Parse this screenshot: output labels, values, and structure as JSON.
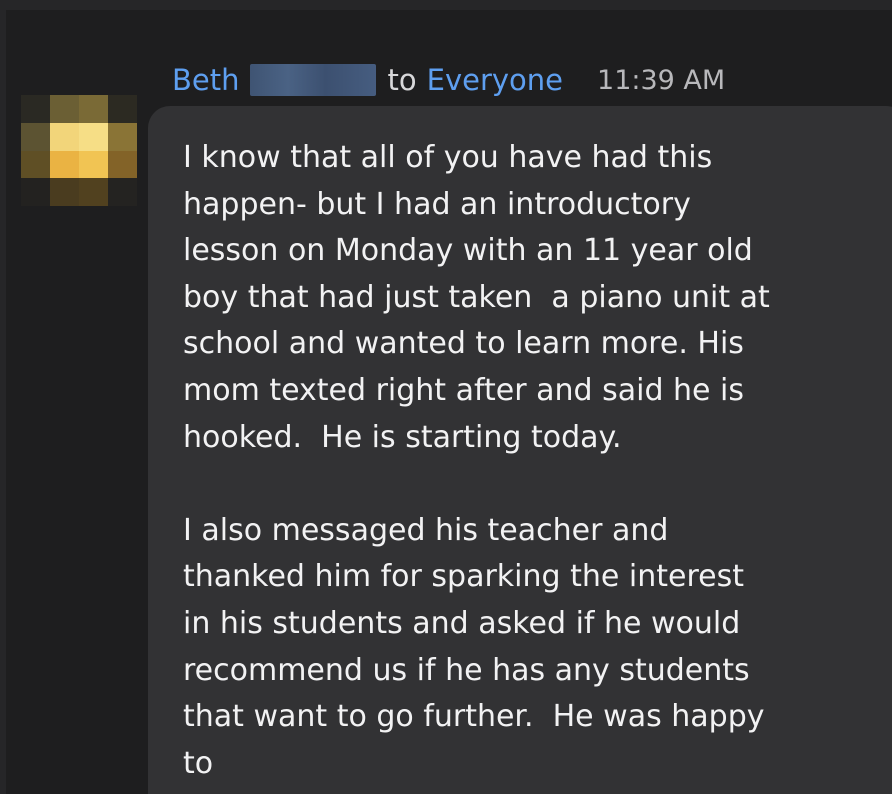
{
  "message": {
    "sender": "Beth",
    "to_label": "to",
    "recipient": "Everyone",
    "time": "11:39 AM",
    "paragraph1": [
      "I know that all of you have had this",
      "happen- but I had an introductory",
      "lesson on Monday with an 11 year old",
      "boy that had just taken  a piano unit at",
      "school and wanted to learn more. His",
      "mom texted right after and said he is",
      "hooked.  He is starting today."
    ],
    "paragraph2": [
      "I also messaged his teacher and",
      "thanked him for sparking the interest",
      "in his students and asked if he would",
      "recommend us if he has any students",
      "that want to go further.  He was happy",
      "to"
    ]
  },
  "colors": {
    "background": "#1e1e1f",
    "bubble": "#323234",
    "name_blue": "#5e9ff0",
    "text": "#f2f2f3"
  }
}
